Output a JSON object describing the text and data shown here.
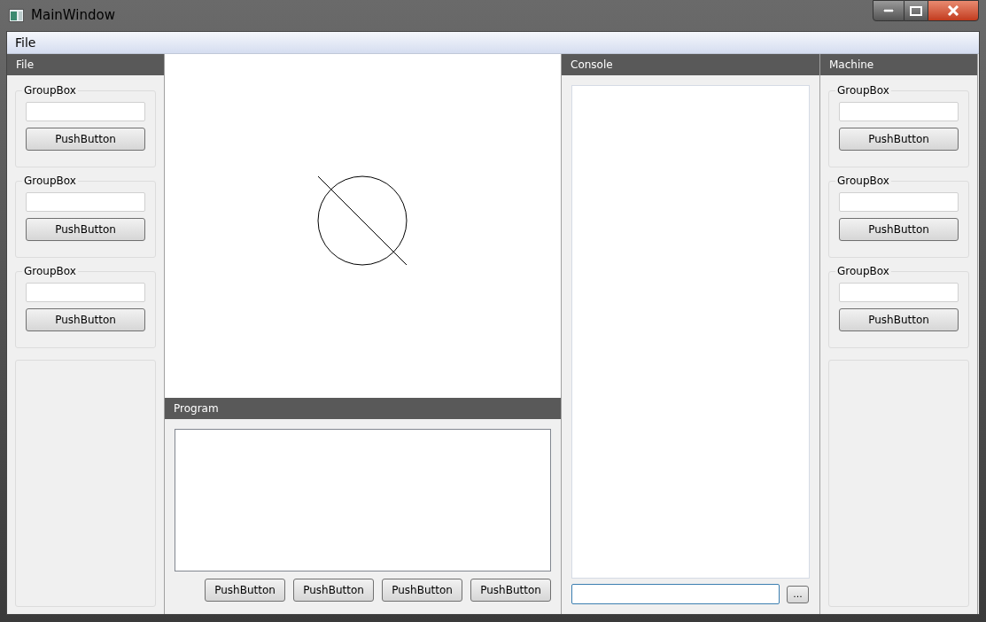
{
  "window": {
    "title": "MainWindow"
  },
  "menu": [
    "File"
  ],
  "left_dock": {
    "title": "File",
    "groups": [
      {
        "title": "GroupBox",
        "button": "PushButton"
      },
      {
        "title": "GroupBox",
        "button": "PushButton"
      },
      {
        "title": "GroupBox",
        "button": "PushButton"
      }
    ]
  },
  "program": {
    "title": "Program",
    "buttons": [
      "PushButton",
      "PushButton",
      "PushButton",
      "PushButton"
    ]
  },
  "console": {
    "title": "Console",
    "input": {
      "focused": true
    },
    "button": "..."
  },
  "right_dock": {
    "title": "Machine",
    "groups": [
      {
        "title": "GroupBox",
        "button": "PushButton"
      },
      {
        "title": "GroupBox",
        "button": "PushButton"
      },
      {
        "title": "GroupBox",
        "button": "PushButton"
      }
    ]
  }
}
